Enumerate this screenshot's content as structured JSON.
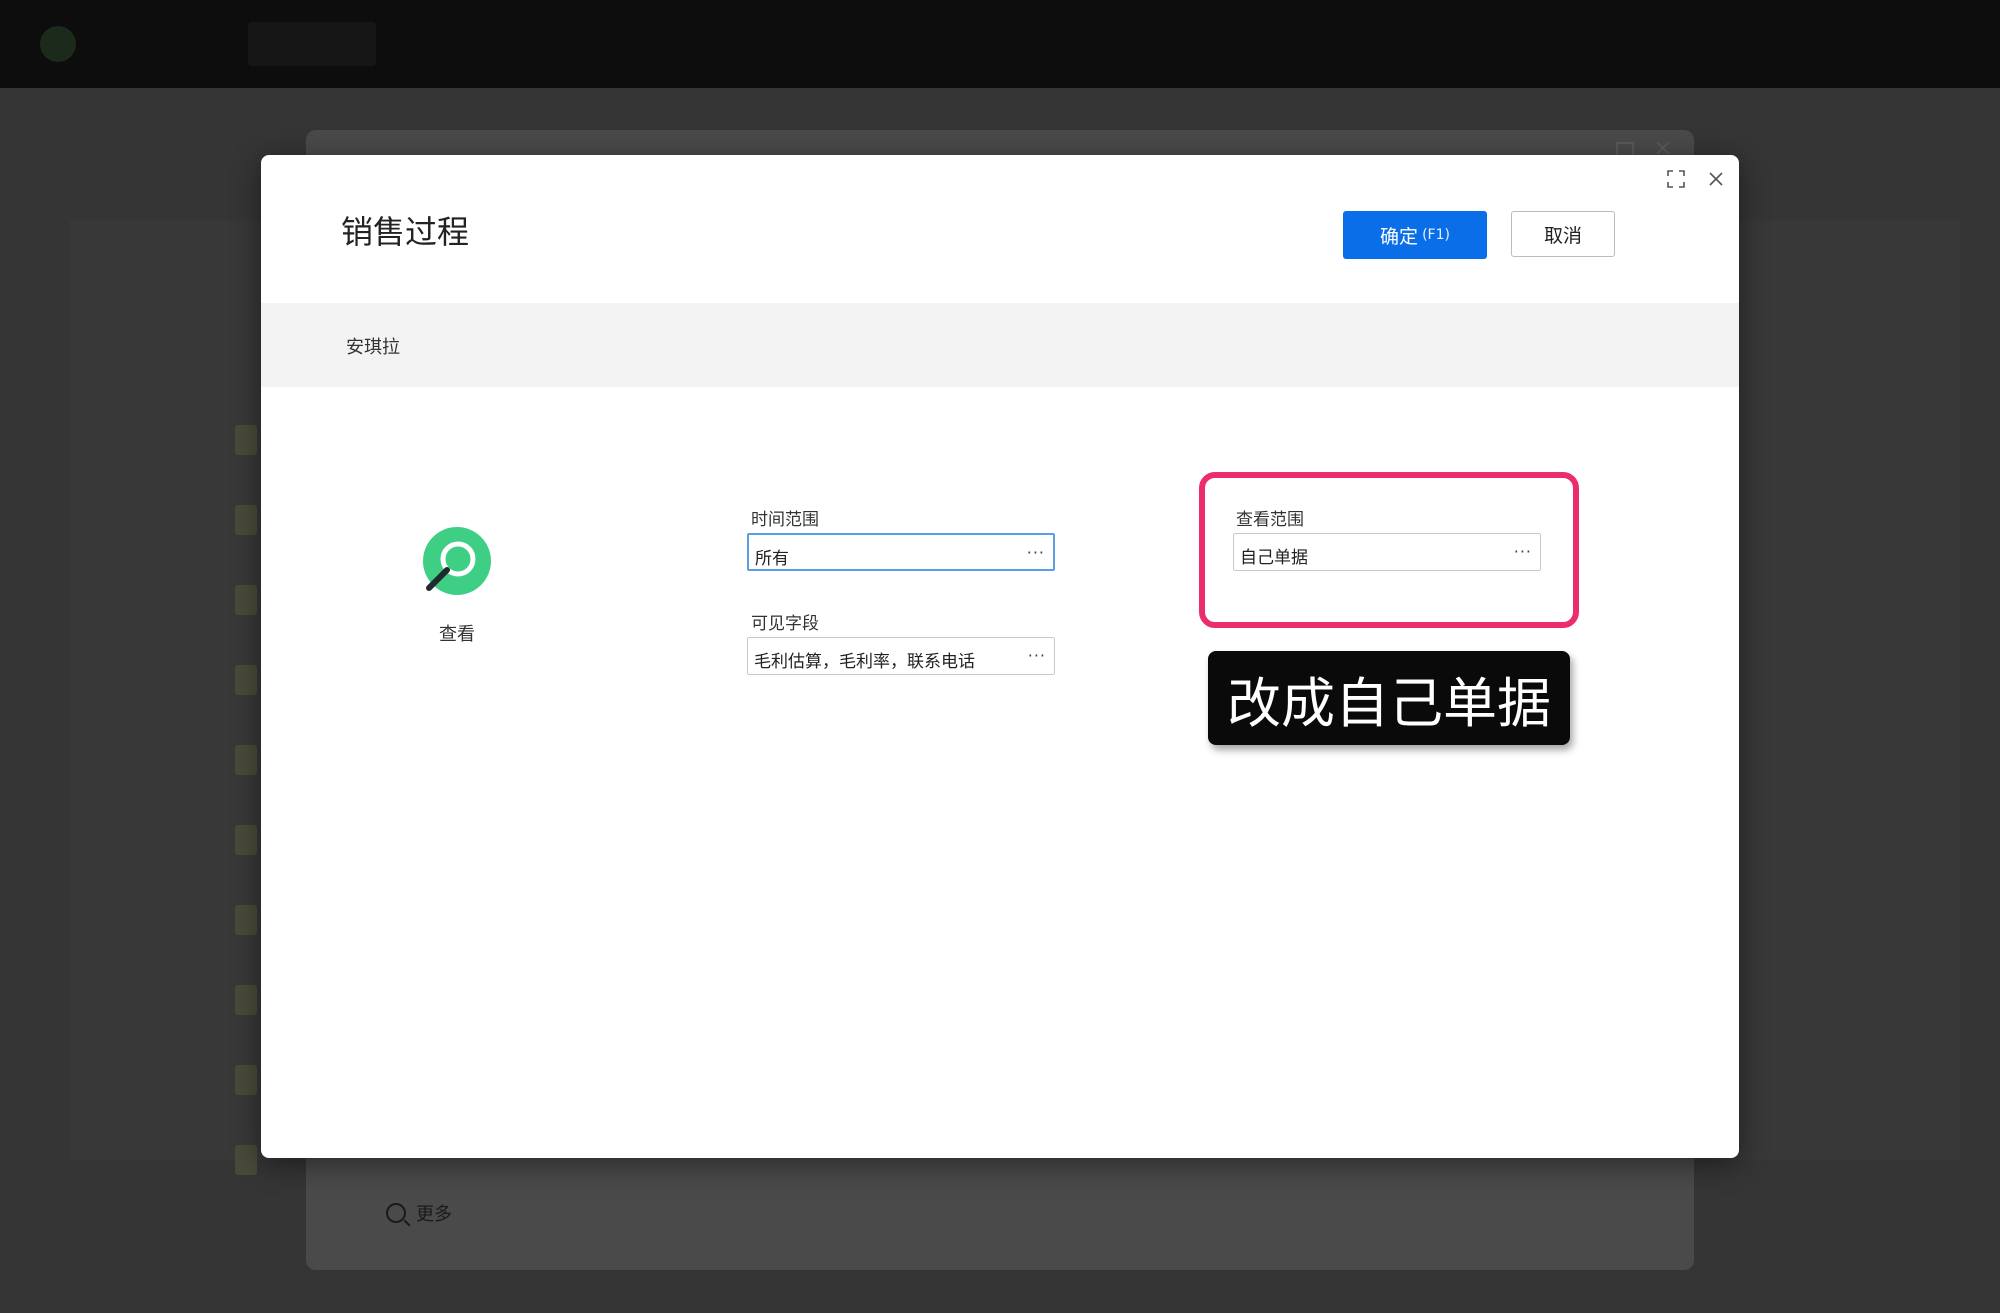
{
  "background_app": {
    "footer_more_label": "更多"
  },
  "dialog": {
    "title": "销售过程",
    "confirm_label": "确定",
    "confirm_hotkey": "(F1)",
    "cancel_label": "取消",
    "user_name": "安琪拉",
    "permission": {
      "icon": "search-icon",
      "label": "查看"
    },
    "fields": {
      "time_range": {
        "label": "时间范围",
        "value": "所有"
      },
      "visible_fields": {
        "label": "可见字段",
        "value": "毛利估算，毛利率，联系电话"
      },
      "view_scope": {
        "label": "查看范围",
        "value": "自己单据"
      }
    },
    "more_button_glyph": "···"
  },
  "annotation": {
    "text": "改成自己单据",
    "highlight_color": "#ec2d6c"
  },
  "colors": {
    "primary": "#0a6ee8",
    "accent_green": "#3ecf84"
  }
}
